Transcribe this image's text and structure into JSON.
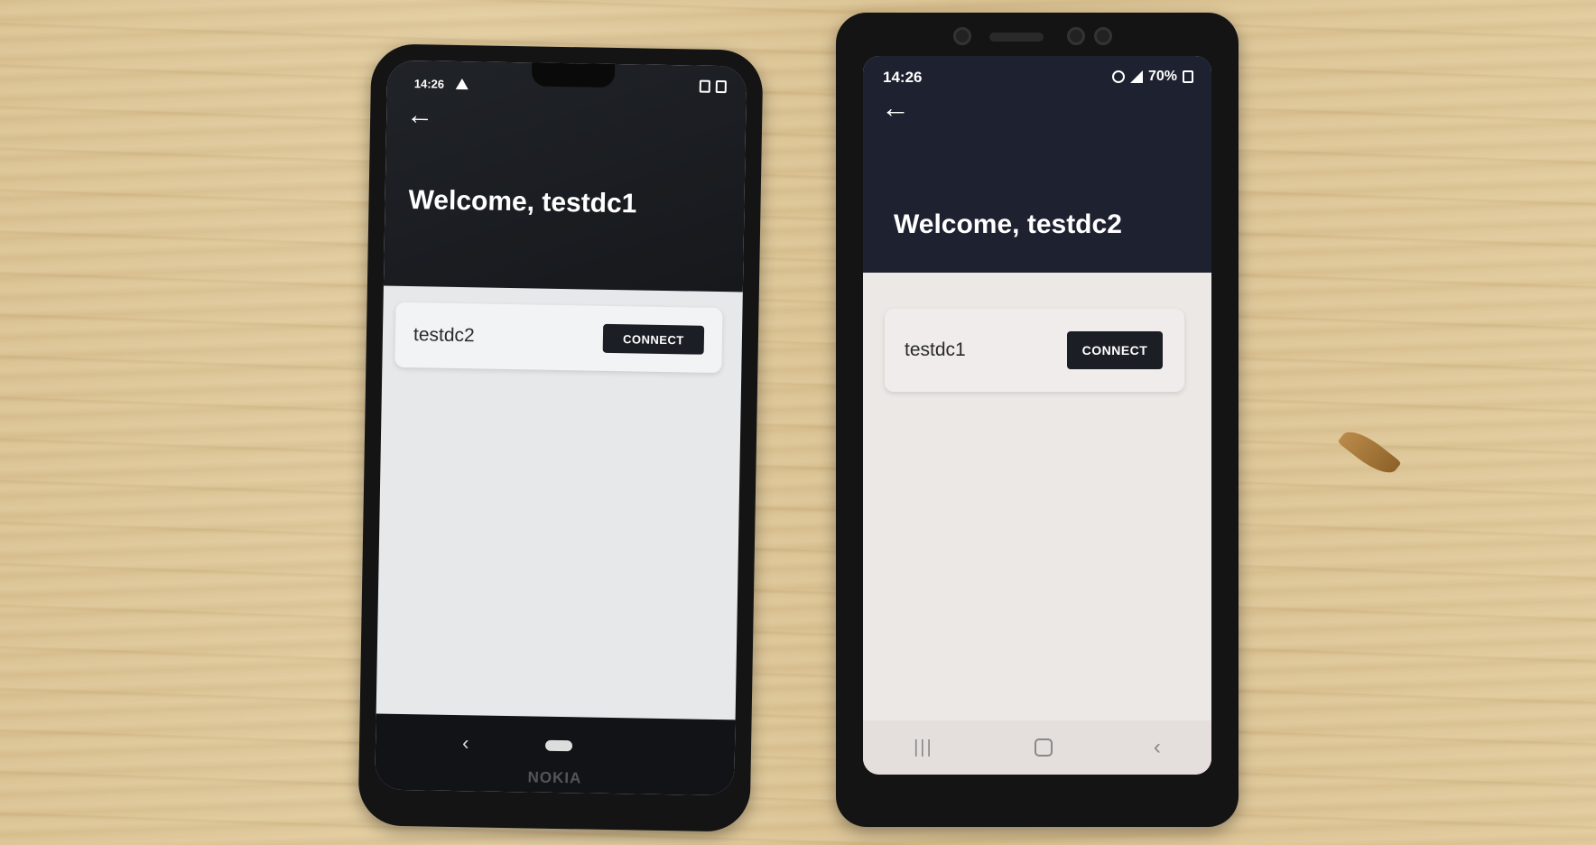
{
  "phone_left": {
    "status_time": "14:26",
    "title": "Welcome, testdc1",
    "peer_name": "testdc2",
    "connect_label": "CONNECT",
    "brand": "NOKIA"
  },
  "phone_right": {
    "status_time": "14:26",
    "battery": "70%",
    "title": "Welcome, testdc2",
    "peer_name": "testdc1",
    "connect_label": "CONNECT"
  }
}
